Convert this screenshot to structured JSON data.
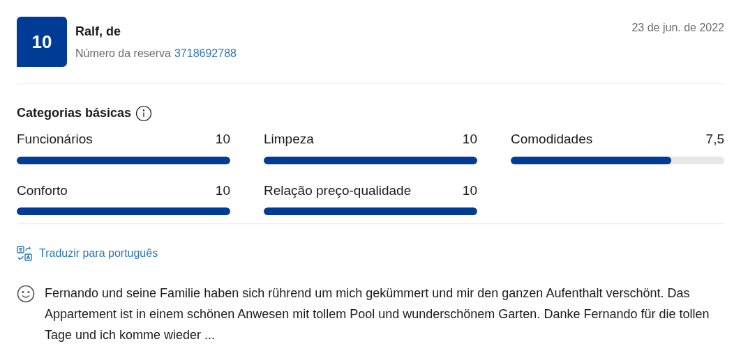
{
  "review": {
    "score": "10",
    "reviewer": "Ralf, de",
    "booking_label": "Número da reserva",
    "booking_number": "3718692788",
    "date": "23 de jun. de 2022"
  },
  "categories": {
    "title": "Categorias básicas",
    "items": [
      {
        "name": "Funcionários",
        "score": "10",
        "level": 1
      },
      {
        "name": "Limpeza",
        "score": "10",
        "level": 1
      },
      {
        "name": "Comodidades",
        "score": "7,5",
        "level": 0.75
      },
      {
        "name": "Conforto",
        "score": "10",
        "level": 1
      },
      {
        "name": "Relação preço-qualidade",
        "score": "10",
        "level": 1
      }
    ]
  },
  "translate_link": "Traduzir para português",
  "comment": {
    "kind": "positive",
    "text": "Fernando und seine Familie haben sich rührend um mich gekümmert und mir den ganzen Aufenthalt verschönt. Das Appartement ist in einem schönen Anwesen mit tollem Pool und wunderschönem Garten. Danke Fernando für die tollen Tage und ich komme wieder ..."
  }
}
